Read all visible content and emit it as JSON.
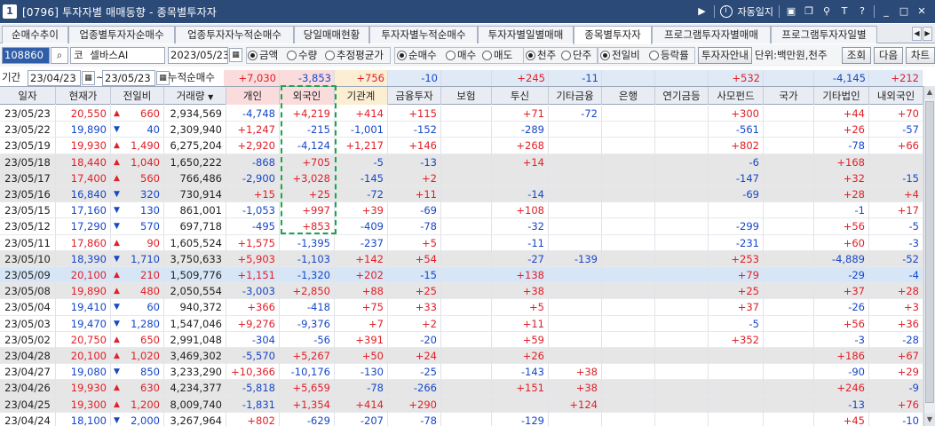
{
  "window": {
    "title": "[0796] 투자자별 매매동향 - 종목별투자자",
    "app_icon": "1",
    "title_controls": [
      "▶",
      "i",
      "자동일지"
    ]
  },
  "tabs": [
    {
      "label": "순매수추이",
      "active": false
    },
    {
      "label": "업종별투자자순매수",
      "active": false
    },
    {
      "label": "업종투자자누적순매수",
      "active": false
    },
    {
      "label": "당일매매현황",
      "active": false
    },
    {
      "label": "투자자별누적순매수",
      "active": false
    },
    {
      "label": "투자자별일별매매",
      "active": false
    },
    {
      "label": "종목별투자자",
      "active": true
    },
    {
      "label": "프로그램투자자별매매",
      "active": false
    },
    {
      "label": "프로그램투자자일별",
      "active": false
    }
  ],
  "toolbar": {
    "code": "108860",
    "market_prefix": "코",
    "stock_name": "셀바스AI",
    "date": "2023/05/23",
    "radio_amount": "금액",
    "radio_qty": "수량",
    "radio_avg": "추정평균가",
    "radio_net": "순매수",
    "radio_buy": "매수",
    "radio_sell": "매도",
    "radio_thousand": "천주",
    "radio_single": "단주",
    "radio_prev": "전일비",
    "radio_rate": "등락률",
    "guide_button": "투자자안내",
    "unit_label": "단위:백만원,천주",
    "query_button": "조회",
    "next_button": "다음",
    "chart_button": "차트"
  },
  "period": {
    "label": "기간",
    "start": "23/04/23",
    "sep": "~",
    "end": "23/05/23",
    "cum_label": "누적순매수"
  },
  "summary": [
    "+7,030",
    "-3,853",
    "+756",
    "-10",
    "",
    "+245",
    "-11",
    "",
    "",
    "+532",
    "",
    "-4,145",
    "+212"
  ],
  "columns": [
    "일자",
    "현재가",
    "전일비",
    "거래량",
    "개인",
    "외국인",
    "기관계",
    "금융투자",
    "보험",
    "투신",
    "기타금융",
    "은행",
    "연기금등",
    "사모펀드",
    "국가",
    "기타법인",
    "내외국인"
  ],
  "rows": [
    [
      "23/05/23",
      "20,550",
      "up",
      "660",
      "2,934,569",
      "-4,748",
      "+4,219",
      "+414",
      "+115",
      "",
      "+71",
      "-72",
      "",
      "",
      "+300",
      "",
      "+44",
      "+70"
    ],
    [
      "23/05/22",
      "19,890",
      "down",
      "40",
      "2,309,940",
      "+1,247",
      "-215",
      "-1,001",
      "-152",
      "",
      "-289",
      "",
      "",
      "",
      "-561",
      "",
      "+26",
      "-57"
    ],
    [
      "23/05/19",
      "19,930",
      "up",
      "1,490",
      "6,275,204",
      "+2,920",
      "-4,124",
      "+1,217",
      "+146",
      "",
      "+268",
      "",
      "",
      "",
      "+802",
      "",
      "-78",
      "+66"
    ],
    [
      "23/05/18",
      "18,440",
      "up",
      "1,040",
      "1,650,222",
      "-868",
      "+705",
      "-5",
      "-13",
      "",
      "+14",
      "",
      "",
      "",
      "-6",
      "",
      "+168",
      ""
    ],
    [
      "23/05/17",
      "17,400",
      "up",
      "560",
      "766,486",
      "-2,900",
      "+3,028",
      "-145",
      "+2",
      "",
      "",
      "",
      "",
      "",
      "-147",
      "",
      "+32",
      "-15"
    ],
    [
      "23/05/16",
      "16,840",
      "down",
      "320",
      "730,914",
      "+15",
      "+25",
      "-72",
      "+11",
      "",
      "-14",
      "",
      "",
      "",
      "-69",
      "",
      "+28",
      "+4"
    ],
    [
      "23/05/15",
      "17,160",
      "down",
      "130",
      "861,001",
      "-1,053",
      "+997",
      "+39",
      "-69",
      "",
      "+108",
      "",
      "",
      "",
      "",
      "",
      "-1",
      "+17"
    ],
    [
      "23/05/12",
      "17,290",
      "down",
      "570",
      "697,718",
      "-495",
      "+853",
      "-409",
      "-78",
      "",
      "-32",
      "",
      "",
      "",
      "-299",
      "",
      "+56",
      "-5"
    ],
    [
      "23/05/11",
      "17,860",
      "up",
      "90",
      "1,605,524",
      "+1,575",
      "-1,395",
      "-237",
      "+5",
      "",
      "-11",
      "",
      "",
      "",
      "-231",
      "",
      "+60",
      "-3"
    ],
    [
      "23/05/10",
      "18,390",
      "down",
      "1,710",
      "3,750,633",
      "+5,903",
      "-1,103",
      "+142",
      "+54",
      "",
      "-27",
      "-139",
      "",
      "",
      "+253",
      "",
      "-4,889",
      "-52"
    ],
    [
      "23/05/09",
      "20,100",
      "up",
      "210",
      "1,509,776",
      "+1,151",
      "-1,320",
      "+202",
      "-15",
      "",
      "+138",
      "",
      "",
      "",
      "+79",
      "",
      "-29",
      "-4"
    ],
    [
      "23/05/08",
      "19,890",
      "up",
      "480",
      "2,050,554",
      "-3,003",
      "+2,850",
      "+88",
      "+25",
      "",
      "+38",
      "",
      "",
      "",
      "+25",
      "",
      "+37",
      "+28"
    ],
    [
      "23/05/04",
      "19,410",
      "down",
      "60",
      "940,372",
      "+366",
      "-418",
      "+75",
      "+33",
      "",
      "+5",
      "",
      "",
      "",
      "+37",
      "",
      "-26",
      "+3"
    ],
    [
      "23/05/03",
      "19,470",
      "down",
      "1,280",
      "1,547,046",
      "+9,276",
      "-9,376",
      "+7",
      "+2",
      "",
      "+11",
      "",
      "",
      "",
      "-5",
      "",
      "+56",
      "+36"
    ],
    [
      "23/05/02",
      "20,750",
      "up",
      "650",
      "2,991,048",
      "-304",
      "-56",
      "+391",
      "-20",
      "",
      "+59",
      "",
      "",
      "",
      "+352",
      "",
      "-3",
      "-28"
    ],
    [
      "23/04/28",
      "20,100",
      "up",
      "1,020",
      "3,469,302",
      "-5,570",
      "+5,267",
      "+50",
      "+24",
      "",
      "+26",
      "",
      "",
      "",
      "",
      "",
      "+186",
      "+67"
    ],
    [
      "23/04/27",
      "19,080",
      "down",
      "850",
      "3,233,290",
      "+10,366",
      "-10,176",
      "-130",
      "-25",
      "",
      "-143",
      "+38",
      "",
      "",
      "",
      "",
      "-90",
      "+29"
    ],
    [
      "23/04/26",
      "19,930",
      "up",
      "630",
      "4,234,377",
      "-5,818",
      "+5,659",
      "-78",
      "-266",
      "",
      "+151",
      "+38",
      "",
      "",
      "",
      "",
      "+246",
      "-9"
    ],
    [
      "23/04/25",
      "19,300",
      "up",
      "1,200",
      "8,009,740",
      "-1,831",
      "+1,354",
      "+414",
      "+290",
      "",
      "",
      "+124",
      "",
      "",
      "",
      "",
      "-13",
      "+76"
    ],
    [
      "23/04/24",
      "18,100",
      "down",
      "2,000",
      "3,267,964",
      "+802",
      "-629",
      "-207",
      "-78",
      "",
      "-129",
      "",
      "",
      "",
      "",
      "",
      "+45",
      "-10"
    ]
  ],
  "colors": {
    "up": "#e0202a",
    "down": "#1747c8",
    "highlight_box": "#19a64a",
    "title_bar": "#2b4a78"
  }
}
